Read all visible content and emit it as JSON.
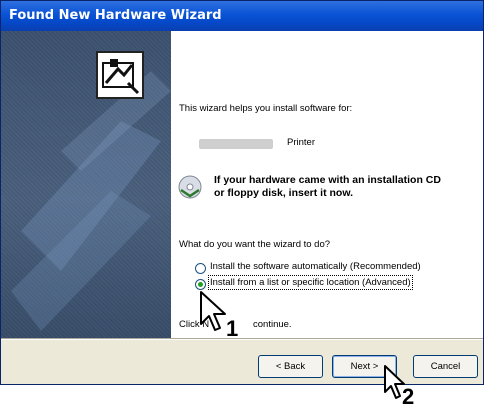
{
  "window": {
    "title": "Found New Hardware Wizard"
  },
  "content": {
    "intro": "This wizard helps you install software for:",
    "device_name_suffix": "Printer",
    "cd_message_line1": "If your hardware came with an installation CD",
    "cd_message_line2": "or floppy disk, insert it now.",
    "question": "What do you want the wizard to do?",
    "options": [
      {
        "label": "Install the software automatically (Recommended)",
        "selected": false
      },
      {
        "label": "Install from a list or specific location (Advanced)",
        "selected": true
      }
    ],
    "click_text_prefix": "Click N",
    "click_text_suffix": "continue."
  },
  "buttons": {
    "back": "< Back",
    "next": "Next >",
    "cancel": "Cancel"
  },
  "callouts": {
    "step1": "1",
    "step2": "2"
  },
  "icons": {
    "wizard": "hardware-wizard-icon",
    "cd": "cd-icon",
    "cursor": "arrow-cursor-icon"
  }
}
